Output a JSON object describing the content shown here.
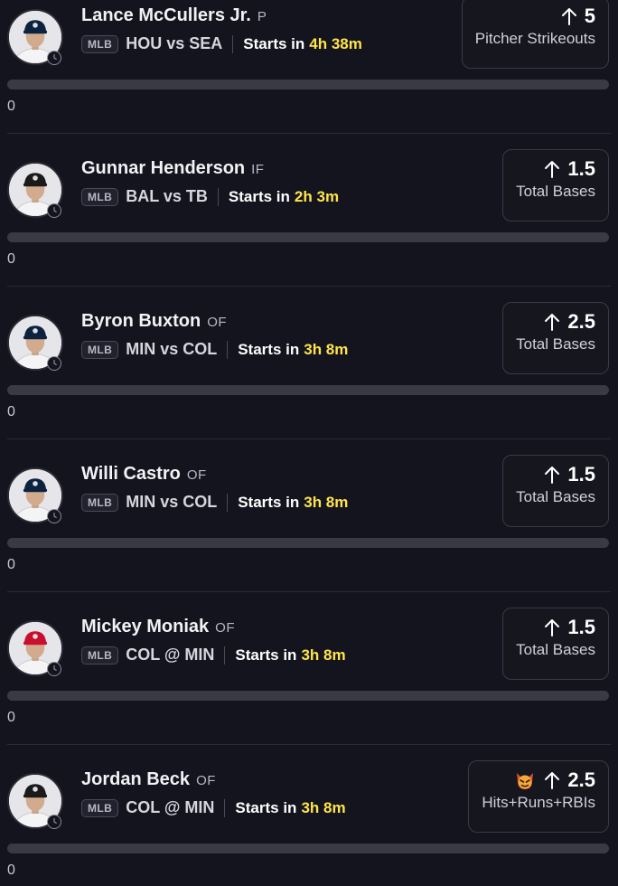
{
  "colors": {
    "background": "#14141f",
    "countdown": "#ffe54a",
    "card_border": "#3a3a48",
    "progress_track": "#3a3a46"
  },
  "players": [
    {
      "name": "Lance McCullers Jr.",
      "position": "P",
      "league": "MLB",
      "matchup": "HOU vs SEA",
      "starts_label": "Starts in",
      "countdown": "4h 38m",
      "direction_icon": "arrow-up-icon",
      "line": "5",
      "stat": "Pitcher Strikeouts",
      "progress_value": "0",
      "progress_fraction": 0,
      "cap_color": "#0c2340",
      "jersey_color": "#f4f4f6",
      "team_icon": "astros-cap-icon",
      "demon": false
    },
    {
      "name": "Gunnar Henderson",
      "position": "IF",
      "league": "MLB",
      "matchup": "BAL vs TB",
      "starts_label": "Starts in",
      "countdown": "2h 3m",
      "direction_icon": "arrow-up-icon",
      "line": "1.5",
      "stat": "Total Bases",
      "progress_value": "0",
      "progress_fraction": 0,
      "cap_color": "#1a1a1a",
      "jersey_color": "#f4f4f6",
      "team_icon": "orioles-cap-icon",
      "demon": false
    },
    {
      "name": "Byron Buxton",
      "position": "OF",
      "league": "MLB",
      "matchup": "MIN vs COL",
      "starts_label": "Starts in",
      "countdown": "3h 8m",
      "direction_icon": "arrow-up-icon",
      "line": "2.5",
      "stat": "Total Bases",
      "progress_value": "0",
      "progress_fraction": 0,
      "cap_color": "#0c2340",
      "jersey_color": "#f4f4f6",
      "team_icon": "twins-cap-icon",
      "demon": false
    },
    {
      "name": "Willi Castro",
      "position": "OF",
      "league": "MLB",
      "matchup": "MIN vs COL",
      "starts_label": "Starts in",
      "countdown": "3h 8m",
      "direction_icon": "arrow-up-icon",
      "line": "1.5",
      "stat": "Total Bases",
      "progress_value": "0",
      "progress_fraction": 0,
      "cap_color": "#0c2340",
      "jersey_color": "#f4f4f6",
      "team_icon": "twins-cap-icon",
      "demon": false
    },
    {
      "name": "Mickey Moniak",
      "position": "OF",
      "league": "MLB",
      "matchup": "COL @ MIN",
      "starts_label": "Starts in",
      "countdown": "3h 8m",
      "direction_icon": "arrow-up-icon",
      "line": "1.5",
      "stat": "Total Bases",
      "progress_value": "0",
      "progress_fraction": 0,
      "cap_color": "#c8102e",
      "jersey_color": "#f4f4f6",
      "team_icon": "angels-cap-icon",
      "demon": false
    },
    {
      "name": "Jordan Beck",
      "position": "OF",
      "league": "MLB",
      "matchup": "COL @ MIN",
      "starts_label": "Starts in",
      "countdown": "3h 8m",
      "direction_icon": "arrow-up-icon",
      "line": "2.5",
      "stat": "Hits+Runs+RBIs",
      "progress_value": "0",
      "progress_fraction": 0,
      "cap_color": "#1a1a1a",
      "jersey_color": "#f4f4f6",
      "team_icon": "rockies-cap-icon",
      "demon": true,
      "badge_icon": "demon-icon"
    }
  ]
}
